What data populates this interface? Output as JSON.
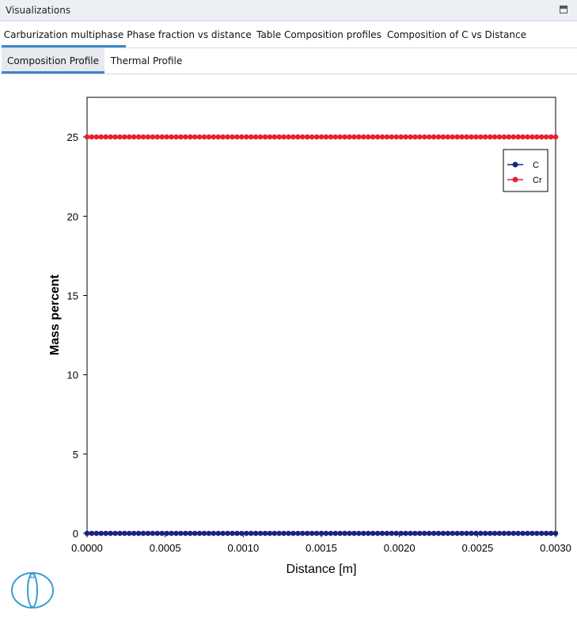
{
  "window": {
    "title": "Visualizations"
  },
  "tabs_row1": [
    {
      "label": "Carburization multiphase",
      "active": true
    },
    {
      "label": "Phase fraction vs distance",
      "active": false
    },
    {
      "label": "Table Composition profiles",
      "active": false
    },
    {
      "label": "Composition of C vs Distance",
      "active": false
    }
  ],
  "tabs_row2": [
    {
      "label": "Composition Profile",
      "active": true
    },
    {
      "label": "Thermal Profile",
      "active": false
    }
  ],
  "colors": {
    "series_C": "#1a237e",
    "series_Cr": "#e8202e",
    "tab_accent": "#3d87c8"
  },
  "icons": {
    "maximize": "maximize-icon",
    "logo": "thermo-calc-logo-icon"
  },
  "chart_data": {
    "type": "line",
    "xlabel": "Distance [m]",
    "ylabel": "Mass percent",
    "xlim": [
      0,
      0.003
    ],
    "ylim": [
      0,
      27.5
    ],
    "xticks": [
      "0.0000",
      "0.0005",
      "0.0010",
      "0.0015",
      "0.0020",
      "0.0025",
      "0.0030"
    ],
    "yticks": [
      "0",
      "5",
      "10",
      "15",
      "20",
      "25"
    ],
    "grid": false,
    "legend_position": "top-right",
    "series": [
      {
        "name": "C",
        "x_range": [
          0,
          0.003
        ],
        "num_points": 101,
        "value": 0.0
      },
      {
        "name": "Cr",
        "x_range": [
          0,
          0.003
        ],
        "num_points": 101,
        "value": 25.0
      }
    ]
  }
}
